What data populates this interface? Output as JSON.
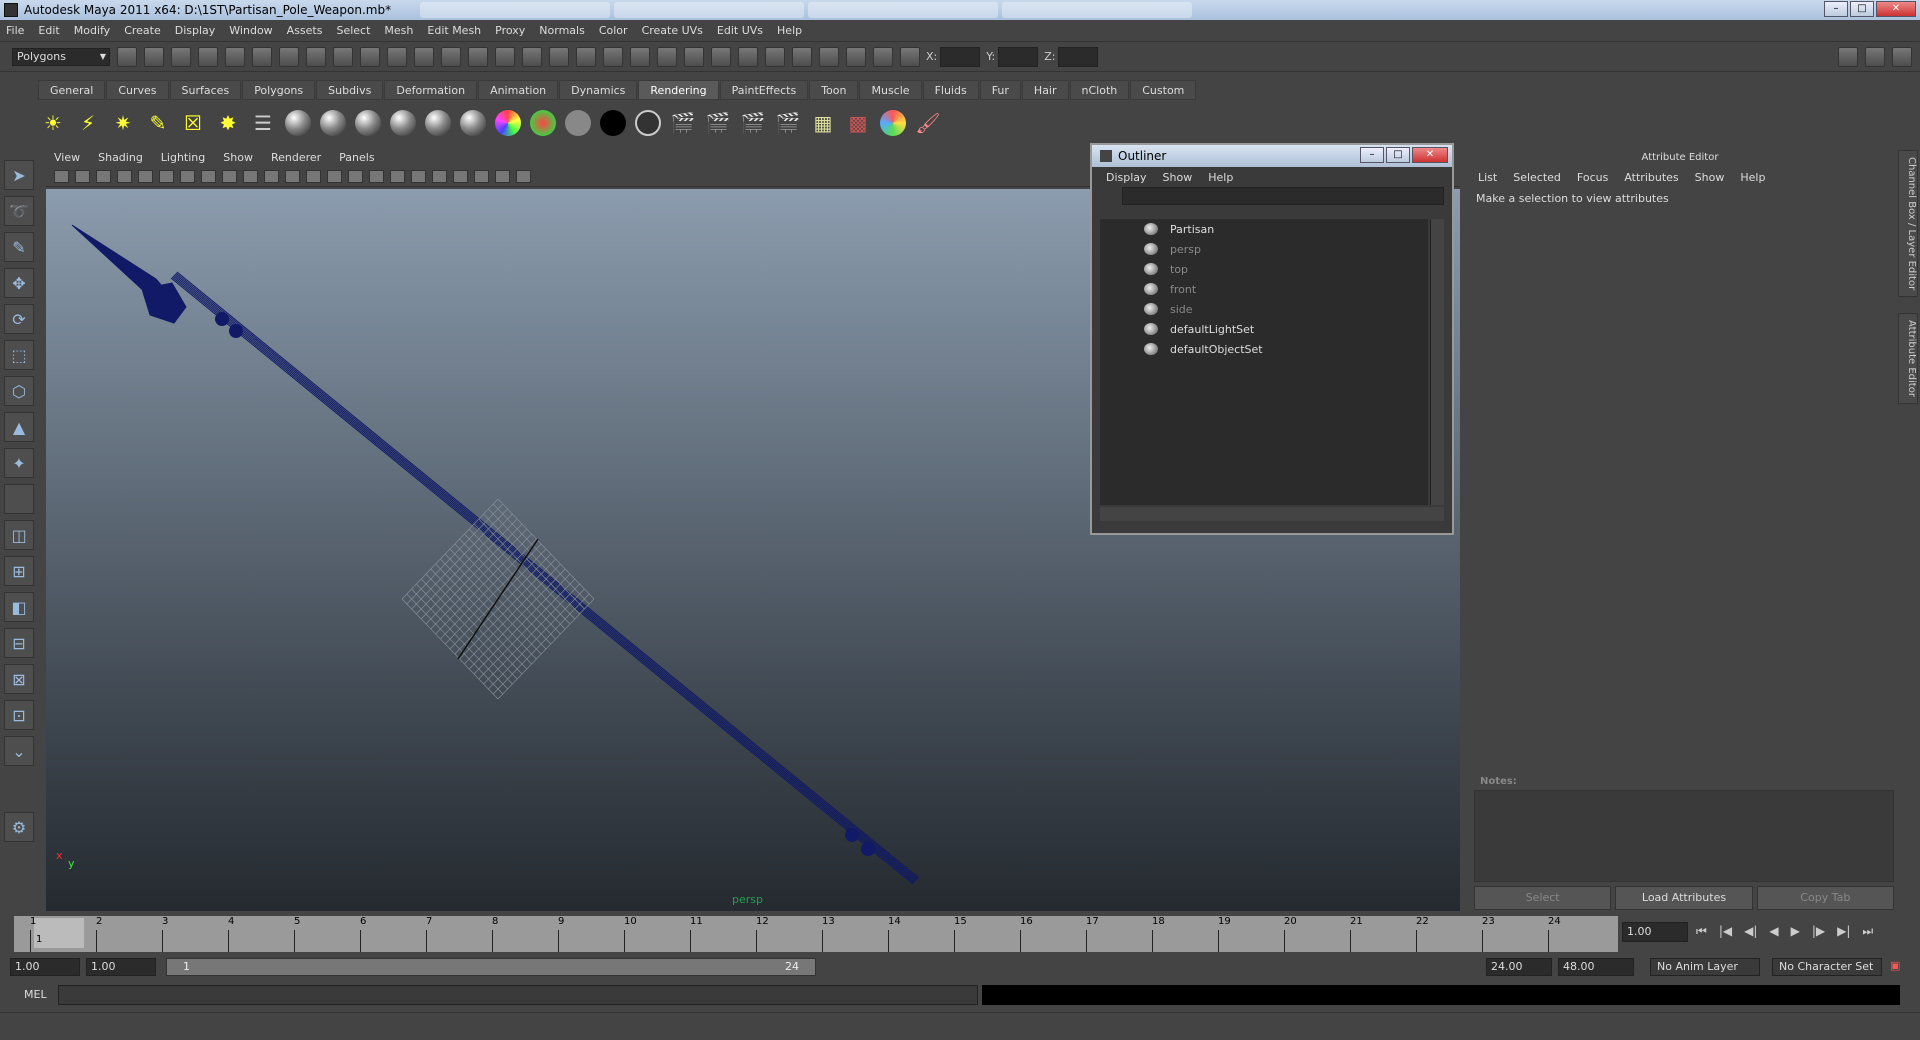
{
  "window": {
    "title": "Autodesk Maya 2011 x64: D:\\1ST\\Partisan_Pole_Weapon.mb*"
  },
  "menubar": [
    "File",
    "Edit",
    "Modify",
    "Create",
    "Display",
    "Window",
    "Assets",
    "Select",
    "Mesh",
    "Edit Mesh",
    "Proxy",
    "Normals",
    "Color",
    "Create UVs",
    "Edit UVs",
    "Help"
  ],
  "statusline": {
    "mode": "Polygons",
    "x_label": "X:",
    "y_label": "Y:",
    "z_label": "Z:"
  },
  "shelf": {
    "tabs": [
      "General",
      "Curves",
      "Surfaces",
      "Polygons",
      "Subdivs",
      "Deformation",
      "Animation",
      "Dynamics",
      "Rendering",
      "PaintEffects",
      "Toon",
      "Muscle",
      "Fluids",
      "Fur",
      "Hair",
      "nCloth",
      "Custom"
    ],
    "active_tab": "Rendering"
  },
  "viewport": {
    "menu": [
      "View",
      "Shading",
      "Lighting",
      "Show",
      "Renderer",
      "Panels"
    ],
    "camera_label": "persp",
    "axis_x": "x",
    "axis_y": "y",
    "wire_color": "#101a66"
  },
  "outliner": {
    "title": "Outliner",
    "menu": [
      "Display",
      "Show",
      "Help"
    ],
    "items": [
      {
        "label": "Partisan",
        "dim": false
      },
      {
        "label": "persp",
        "dim": true
      },
      {
        "label": "top",
        "dim": true
      },
      {
        "label": "front",
        "dim": true
      },
      {
        "label": "side",
        "dim": true
      },
      {
        "label": "defaultLightSet",
        "dim": false
      },
      {
        "label": "defaultObjectSet",
        "dim": false
      }
    ]
  },
  "attribute_editor": {
    "title": "Attribute Editor",
    "menu": [
      "List",
      "Selected",
      "Focus",
      "Attributes",
      "Show",
      "Help"
    ],
    "message": "Make a selection to view attributes",
    "notes_label": "Notes:",
    "buttons": {
      "select": "Select",
      "load": "Load Attributes",
      "copy": "Copy Tab"
    }
  },
  "side_tabs": {
    "channel_box": "Channel Box / Layer Editor",
    "attribute_editor": "Attribute Editor"
  },
  "timeslider": {
    "ticks": [
      "1",
      "2",
      "3",
      "4",
      "5",
      "6",
      "7",
      "8",
      "9",
      "10",
      "11",
      "12",
      "13",
      "14",
      "15",
      "16",
      "17",
      "18",
      "19",
      "20",
      "21",
      "22",
      "23",
      "24"
    ],
    "current_frame": "1",
    "current_time": "1.00"
  },
  "rangeslider": {
    "start": "1.00",
    "playback_start": "1.00",
    "bar_start": "1",
    "bar_end": "24",
    "playback_end": "24.00",
    "end": "48.00",
    "anim_layer": "No Anim Layer",
    "char_set": "No Character Set"
  },
  "cmdline": {
    "label": "MEL"
  }
}
